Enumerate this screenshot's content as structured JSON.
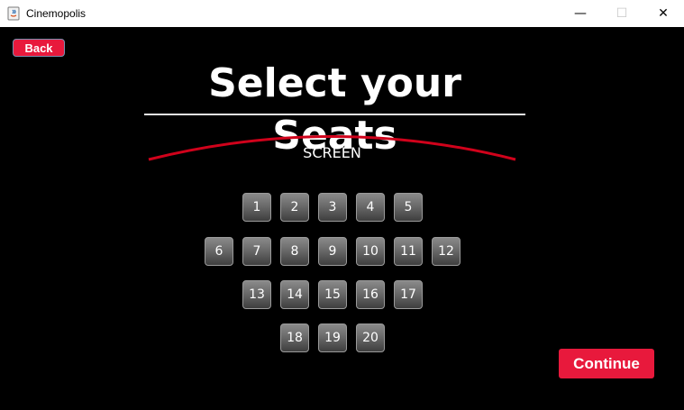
{
  "window": {
    "title": "Cinemopolis",
    "minimize_glyph": "—",
    "maximize_glyph": "☐",
    "close_glyph": "✕"
  },
  "header": {
    "back_label": "Back",
    "title": "Select your Seats"
  },
  "screen": {
    "label": "SCREEN",
    "arc_color": "#d0021b"
  },
  "seats": {
    "row1": [
      "1",
      "2",
      "3",
      "4",
      "5"
    ],
    "row2": [
      "6",
      "7",
      "8",
      "9",
      "10",
      "11",
      "12"
    ],
    "row3": [
      "13",
      "14",
      "15",
      "16",
      "17"
    ],
    "row4": [
      "18",
      "19",
      "20"
    ]
  },
  "footer": {
    "continue_label": "Continue"
  },
  "colors": {
    "accent": "#e8193c",
    "background": "#000000"
  }
}
